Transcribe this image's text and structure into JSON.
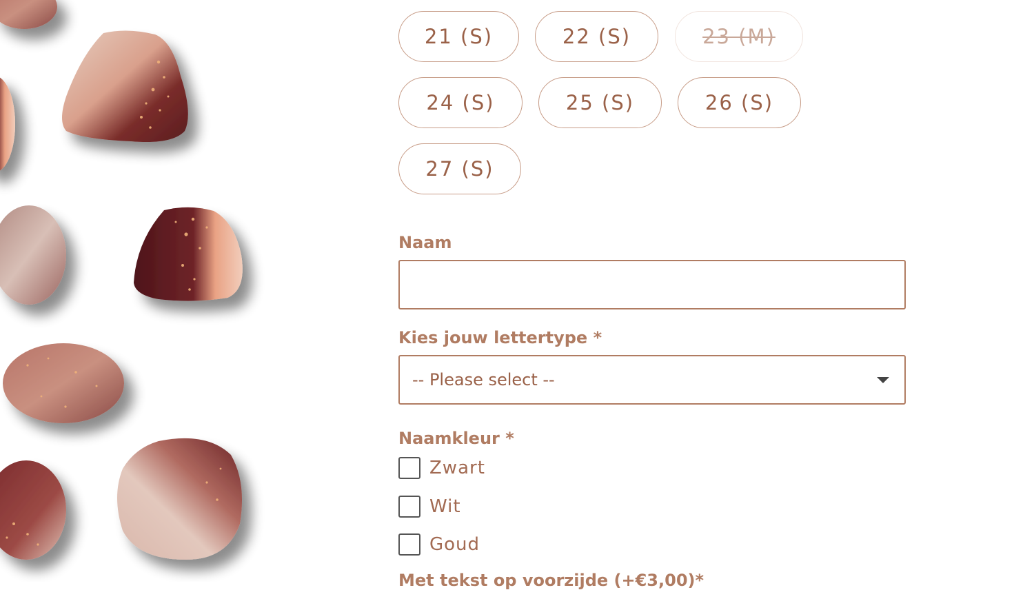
{
  "product_image": {
    "alt": ""
  },
  "colors": {
    "accent": "#b07c62",
    "button_border": "#c79c87",
    "button_text": "#9a6148",
    "disabled_border": "#f1e4de",
    "disabled_text": "#c9a899",
    "checkbox_border": "#555555"
  },
  "sizes": [
    {
      "label": "21 (S)",
      "available": true
    },
    {
      "label": "22 (S)",
      "available": true
    },
    {
      "label": "23 (M)",
      "available": false
    },
    {
      "label": "24 (S)",
      "available": true
    },
    {
      "label": "25 (S)",
      "available": true
    },
    {
      "label": "26 (S)",
      "available": true
    },
    {
      "label": "27 (S)",
      "available": true
    }
  ],
  "form": {
    "name_label": "Naam",
    "name_value": "",
    "font_label": "Kies jouw lettertype *",
    "font_selected": "-- Please select --",
    "color_label": "Naamkleur *",
    "color_options": [
      {
        "label": "Zwart",
        "checked": false
      },
      {
        "label": "Wit",
        "checked": false
      },
      {
        "label": "Goud",
        "checked": false
      }
    ],
    "next_label": "Met tekst op voorzijde (+€3,00)*"
  }
}
